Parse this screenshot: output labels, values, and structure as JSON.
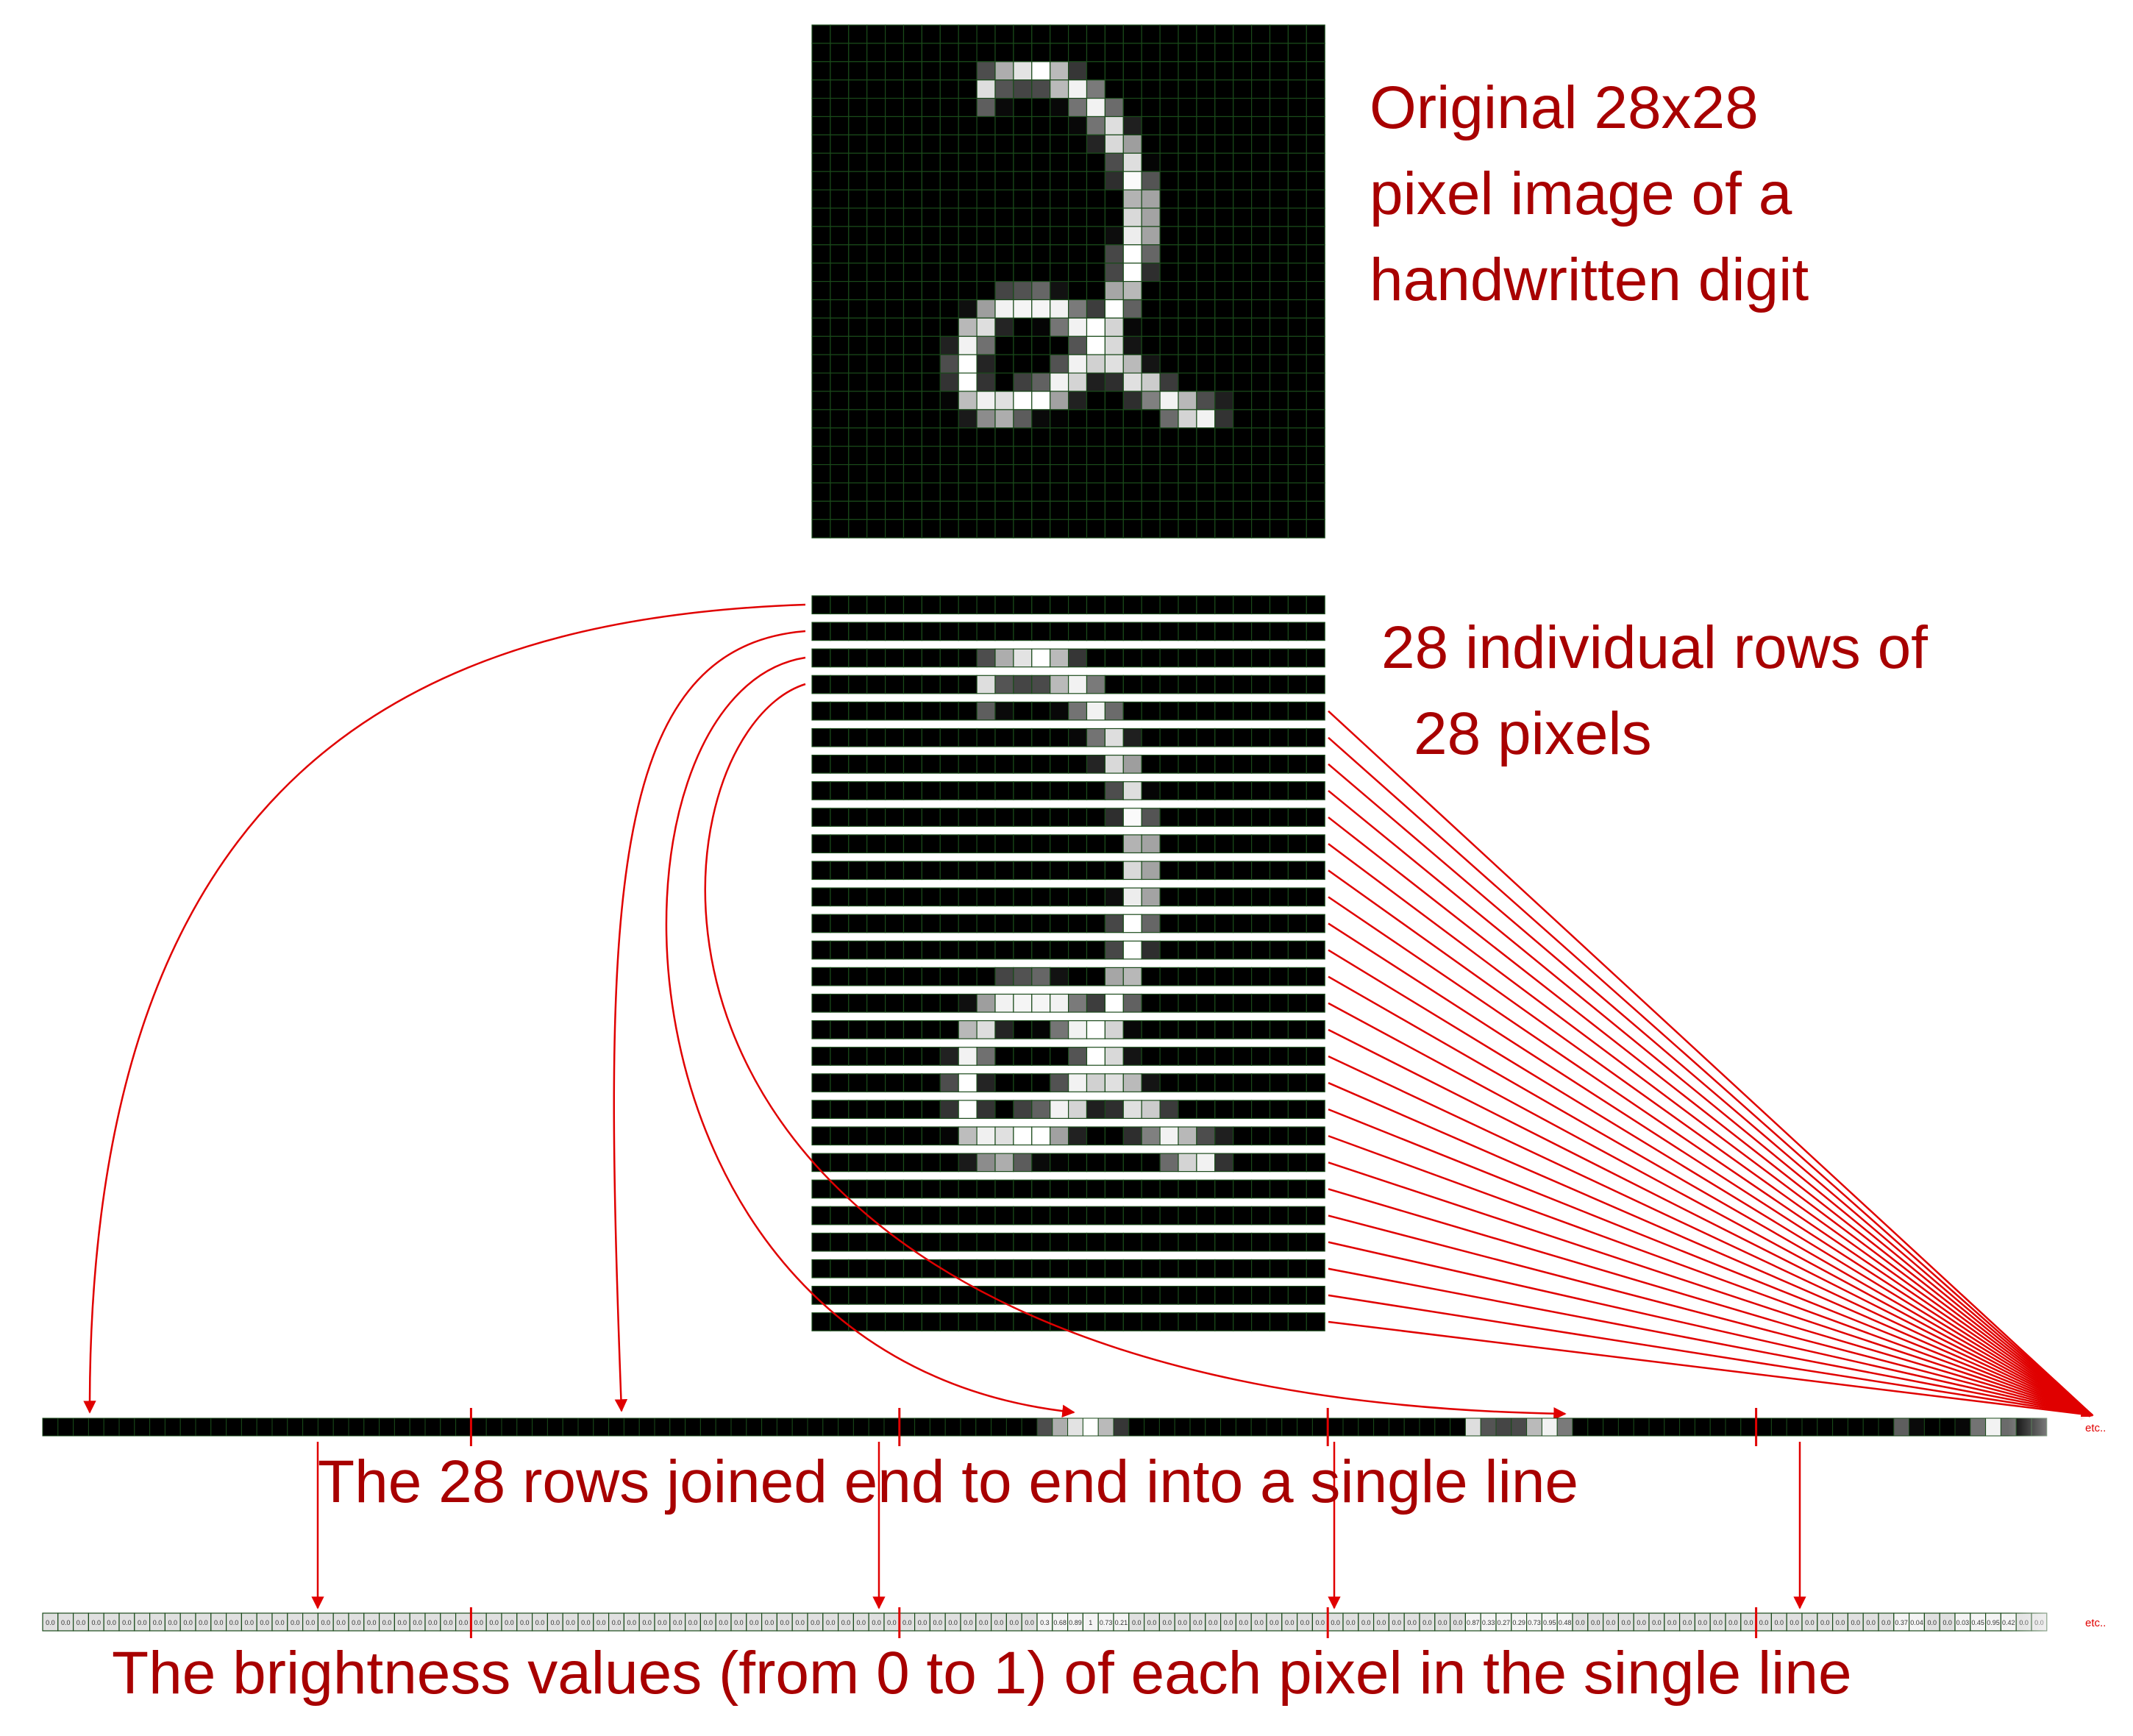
{
  "labels": {
    "original_line1": "Original 28x28",
    "original_line2": "pixel image of a",
    "original_line3": "handwritten digit",
    "rows_line1": "28 individual rows of",
    "rows_line2": "28 pixels",
    "joined": "The 28 rows joined end to end into a single line",
    "values": "The brightness values (from 0 to 1) of each pixel in the single line",
    "etc": "etc.."
  },
  "colors": {
    "label": "#a80000",
    "arrow": "#e00000",
    "grid": "#1a4a1a",
    "value_bg": "#e0e0e0"
  },
  "image": {
    "width": 28,
    "height": 28,
    "pixels": {
      "2": {
        "9": 0.3,
        "10": 0.68,
        "11": 0.89,
        "12": 1.0,
        "13": 0.73,
        "14": 0.21
      },
      "3": {
        "9": 0.87,
        "10": 0.33,
        "11": 0.27,
        "12": 0.29,
        "13": 0.73,
        "14": 0.95,
        "15": 0.48
      },
      "4": {
        "9": 0.37,
        "10": 0.04,
        "13": 0.03,
        "14": 0.45,
        "15": 0.95,
        "16": 0.42
      },
      "5": {
        "14": 0.03,
        "15": 0.45,
        "16": 0.87,
        "17": 0.12
      },
      "6": {
        "15": 0.14,
        "16": 0.85,
        "17": 0.62
      },
      "7": {
        "16": 0.3,
        "17": 0.87,
        "18": 0.02
      },
      "8": {
        "16": 0.18,
        "17": 0.98,
        "18": 0.33
      },
      "9": {
        "17": 0.7,
        "18": 0.64
      },
      "10": {
        "17": 0.85,
        "18": 0.64
      },
      "11": {
        "16": 0.05,
        "17": 0.93,
        "18": 0.64
      },
      "12": {
        "16": 0.28,
        "17": 1.0,
        "18": 0.4
      },
      "13": {
        "16": 0.28,
        "17": 1.0,
        "18": 0.18
      },
      "14": {
        "10": 0.27,
        "11": 0.32,
        "12": 0.4,
        "13": 0.07,
        "16": 0.65,
        "17": 0.72
      },
      "15": {
        "8": 0.06,
        "9": 0.62,
        "10": 0.95,
        "11": 0.96,
        "12": 0.96,
        "13": 0.95,
        "14": 0.48,
        "15": 0.24,
        "16": 1.0,
        "17": 0.38
      },
      "16": {
        "8": 0.72,
        "9": 0.87,
        "10": 0.14,
        "12": 0.02,
        "13": 0.46,
        "14": 0.95,
        "15": 1.0,
        "16": 0.83,
        "17": 0.03
      },
      "17": {
        "7": 0.13,
        "8": 0.95,
        "9": 0.44,
        "13": 0.0,
        "14": 0.33,
        "15": 1.0,
        "16": 0.85,
        "17": 0.08
      },
      "18": {
        "7": 0.3,
        "8": 1.0,
        "9": 0.14,
        "13": 0.32,
        "14": 0.95,
        "15": 0.82,
        "16": 0.88,
        "17": 0.73,
        "18": 0.08
      },
      "19": {
        "7": 0.2,
        "8": 1.0,
        "9": 0.2,
        "11": 0.25,
        "12": 0.38,
        "13": 0.95,
        "14": 0.83,
        "15": 0.12,
        "16": 0.18,
        "17": 0.88,
        "18": 0.8,
        "19": 0.23
      },
      "20": {
        "7": 0.02,
        "8": 0.74,
        "9": 0.94,
        "10": 0.88,
        "11": 1.0,
        "12": 1.0,
        "13": 0.63,
        "14": 0.13,
        "17": 0.18,
        "18": 0.5,
        "19": 0.95,
        "20": 0.72,
        "21": 0.3,
        "22": 0.12
      },
      "21": {
        "8": 0.1,
        "9": 0.55,
        "10": 0.68,
        "11": 0.36,
        "12": 0.04,
        "13": 0.01,
        "19": 0.42,
        "20": 0.83,
        "21": 0.95,
        "22": 0.2
      }
    }
  },
  "single_line": {
    "rows_shown": 5,
    "row_boundaries_marked": true
  },
  "value_strip": {
    "row2_nonzero": [
      "0.3",
      "0.68",
      "0.89",
      "1.0",
      "0.73",
      "0.21"
    ],
    "row3_nonzero": [
      "0.87",
      "0.33",
      "0.27",
      "0.29",
      "0.73",
      "0.95",
      "0.48"
    ],
    "zero_label": "0.0"
  }
}
